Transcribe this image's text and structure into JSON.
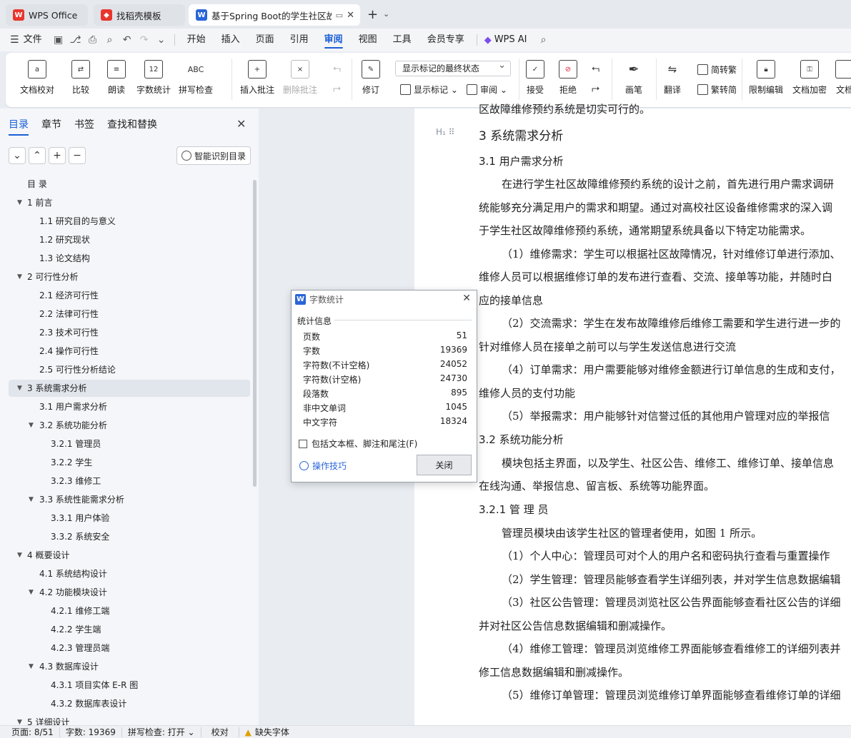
{
  "tabs": [
    {
      "label": "WPS Office",
      "icon": "W",
      "color": "#e8362d"
    },
    {
      "label": "找稻壳模板",
      "icon": "◆",
      "color": "#e8362d"
    },
    {
      "label": "基于Spring Boot的学生社区故",
      "icon": "W",
      "color": "#2a65d8"
    }
  ],
  "menubar": {
    "file": "文件",
    "items": [
      "开始",
      "插入",
      "页面",
      "引用",
      "审阅",
      "视图",
      "工具",
      "会员专享"
    ],
    "active": "审阅",
    "ai": "WPS AI"
  },
  "ribbon": {
    "proof": "文档校对",
    "compare": "比较",
    "read": "朗读",
    "wordcount": "字数统计",
    "spell": "拼写检查",
    "insert_comment": "插入批注",
    "delete_comment": "删除批注",
    "revise": "修订",
    "markup_state": "显示标记的最终状态",
    "show_markup": "显示标记",
    "review": "审阅",
    "accept": "接受",
    "reject": "拒绝",
    "brush": "画笔",
    "translate": "翻译",
    "to_trad": "简转繁",
    "to_simp": "繁转简",
    "restrict": "限制编辑",
    "encrypt": "文档加密",
    "doc": "文档",
    "wordcount_icon_text": "12",
    "spell_icon_text": "ABC"
  },
  "left": {
    "tabs": [
      "目录",
      "章节",
      "书签",
      "查找和替换"
    ],
    "smart": "智能识别目录",
    "toc": [
      {
        "label": "目      录",
        "level": 0
      },
      {
        "label": "1  前言",
        "level": 1
      },
      {
        "label": "1.1   研究目的与意义",
        "level": 2
      },
      {
        "label": "1.2   研究现状",
        "level": 2
      },
      {
        "label": "1.3   论文结构",
        "level": 2
      },
      {
        "label": "2   可行性分析",
        "level": 1
      },
      {
        "label": "2.1   经济可行性",
        "level": 2
      },
      {
        "label": "2.2   法律可行性",
        "level": 2
      },
      {
        "label": "2.3   技术可行性",
        "level": 2
      },
      {
        "label": "2.4   操作可行性",
        "level": 2
      },
      {
        "label": "2.5   可行性分析结论",
        "level": 2
      },
      {
        "label": "3   系统需求分析",
        "level": 1
      },
      {
        "label": "3.1   用户需求分析",
        "level": 2
      },
      {
        "label": "3.2   系统功能分析",
        "level": 2
      },
      {
        "label": "3.2.1   管理员",
        "level": 3
      },
      {
        "label": "3.2.2   学生",
        "level": 3
      },
      {
        "label": "3.2.3   维修工",
        "level": 3
      },
      {
        "label": "3.3   系统性能需求分析",
        "level": 2
      },
      {
        "label": "3.3.1   用户体验",
        "level": 3
      },
      {
        "label": "3.3.2   系统安全",
        "level": 3
      },
      {
        "label": "4   概要设计",
        "level": 1
      },
      {
        "label": "4.1   系统结构设计",
        "level": 2
      },
      {
        "label": "4.2   功能模块设计",
        "level": 2
      },
      {
        "label": "4.2.1   维修工端",
        "level": 3
      },
      {
        "label": "4.2.2   学生端",
        "level": 3
      },
      {
        "label": "4.2.3   管理员端",
        "level": 3
      },
      {
        "label": "4.3   数据库设计",
        "level": 2
      },
      {
        "label": "4.3.1   项目实体 E-R 图",
        "level": 3
      },
      {
        "label": "4.3.2   数据库表设计",
        "level": 3
      },
      {
        "label": "5   详细设计",
        "level": 1
      }
    ]
  },
  "doc": {
    "top_partial": "区故障维修预约系统是切实可行的。",
    "lines": [
      "3    系统需求分析",
      "3.1    用户需求分析",
      "在进行学生社区故障维修预约系统的设计之前，首先进行用户需求调研",
      "统能够充分满足用户的需求和期望。通过对高校社区设备维修需求的深入调",
      "于学生社区故障维修预约系统，通常期望系统具备以下特定功能需求。",
      "（1）维修需求：学生可以根据社区故障情况，针对维修订单进行添加、",
      "维修人员可以根据维修订单的发布进行查看、交流、接单等功能，并随时白",
      "应的接单信息",
      "（2）交流需求：学生在发布故障维修后维修工需要和学生进行进一步的",
      "针对维修人员在接单之前可以与学生发送信息进行交流",
      "（4）订单需求：用户需要能够对维修金额进行订单信息的生成和支付，",
      "维修人员的支付功能",
      "（5）举报需求：用户能够针对信誉过低的其他用户管理对应的举报信",
      "3.2    系统功能分析",
      "模块包括主界面，以及学生、社区公告、维修工、维修订单、接单信息",
      "在线沟通、举报信息、留言板、系统等功能界面。",
      "3.2.1    管 理 员",
      "管理员模块由该学生社区的管理者使用，如图 1 所示。",
      "（1）个人中心：管理员可对个人的用户名和密码执行查看与重置操作",
      "（2）学生管理：管理员能够查看学生详细列表，并对学生信息数据编辑",
      "（3）社区公告管理：管理员浏览社区公告界面能够查看社区公告的详细",
      "并对社区公告信息数据编辑和删减操作。",
      "（4）维修工管理：管理员浏览维修工界面能够查看维修工的详细列表并",
      "修工信息数据编辑和删减操作。",
      "（5）维修订单管理：管理员浏览维修订单界面能够查看维修订单的详细"
    ]
  },
  "dialog": {
    "title": "字数统计",
    "group": "统计信息",
    "rows": [
      {
        "label": "页数",
        "value": "51"
      },
      {
        "label": "字数",
        "value": "19369"
      },
      {
        "label": "字符数(不计空格)",
        "value": "24052"
      },
      {
        "label": "字符数(计空格)",
        "value": "24730"
      },
      {
        "label": "段落数",
        "value": "895"
      },
      {
        "label": "非中文单词",
        "value": "1045"
      },
      {
        "label": "中文字符",
        "value": "18324"
      }
    ],
    "checkbox": "包括文本框、脚注和尾注(F)",
    "tips": "操作技巧",
    "close": "关闭"
  },
  "status": {
    "page": "页面: 8/51",
    "words": "字数: 19369",
    "spell": "拼写检查: 打开",
    "proof": "校对",
    "font_missing": "缺失字体"
  }
}
